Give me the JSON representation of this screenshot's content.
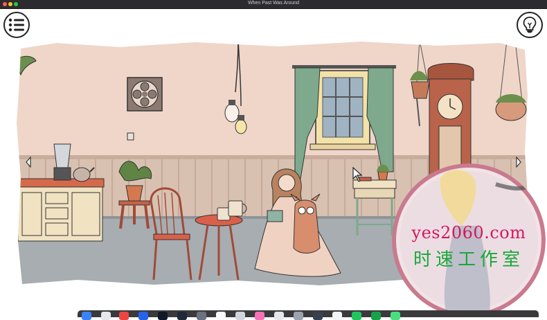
{
  "window": {
    "title": "When Past Was Around"
  },
  "hud": {
    "menu_icon": "list-icon",
    "hint_icon": "lightbulb-icon"
  },
  "scene": {
    "room": "living-room",
    "left_arrow_icon": "chevron-left-icon",
    "right_arrow_icon": "chevron-right-icon"
  },
  "watermark": {
    "line1": "yes2060.com",
    "line2": "时速工作室"
  },
  "colors": {
    "wall": "#efd6c9",
    "wainscot": "#d9c1b1",
    "floor": "#a7adb0",
    "curtain": "#7ea98d",
    "counter": "#d56a4a",
    "table": "#d9604a",
    "watermark_red": "#d4185a",
    "watermark_green": "#19a83a"
  }
}
